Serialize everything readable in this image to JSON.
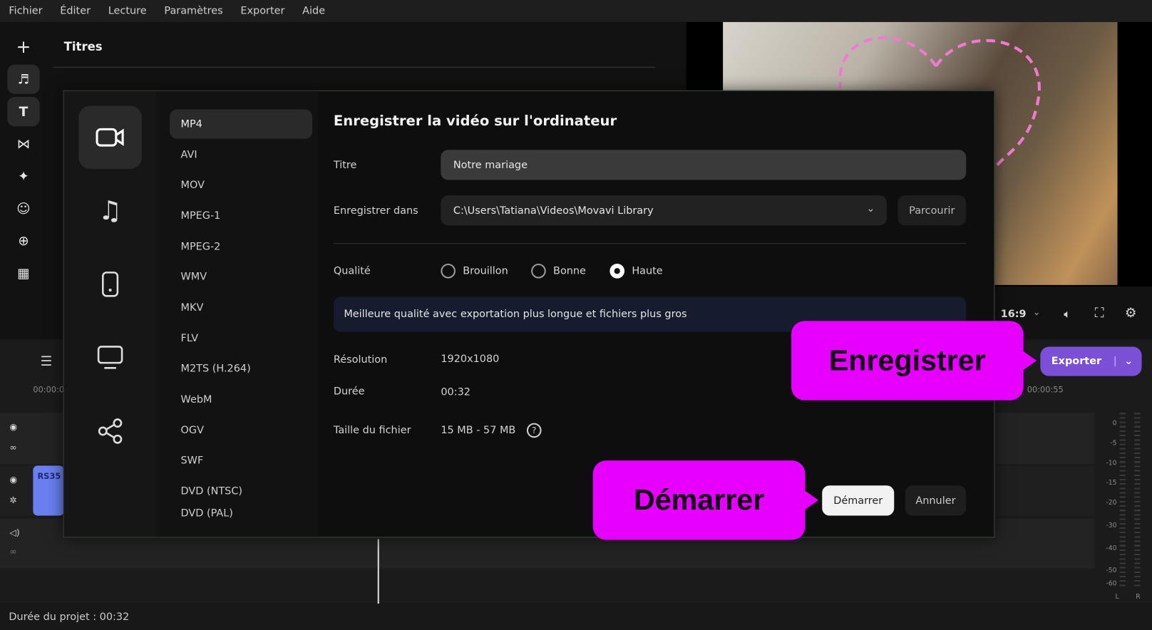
{
  "menu": [
    "Fichier",
    "Éditer",
    "Lecture",
    "Paramètres",
    "Exporter",
    "Aide"
  ],
  "panel": {
    "title": "Titres"
  },
  "player": {
    "aspect": "16:9"
  },
  "timeline": {
    "time_start": "00:00:0",
    "time_end": "00:00:55",
    "clip_label": "RS35"
  },
  "vu_scale": [
    "0",
    "-5",
    "-10",
    "-15",
    "-20",
    "-30",
    "-40",
    "-50",
    "-60"
  ],
  "vu_channels": [
    "L",
    "R"
  ],
  "export_button": "Exporter",
  "footer": {
    "duration": "Durée du projet : 00:32"
  },
  "dialog": {
    "heading": "Enregistrer la vidéo sur l'ordinateur",
    "formats": [
      "MP4",
      "AVI",
      "MOV",
      "MPEG-1",
      "MPEG-2",
      "WMV",
      "MKV",
      "FLV",
      "M2TS (H.264)",
      "WebM",
      "OGV",
      "SWF",
      "DVD (NTSC)",
      "DVD (PAL)"
    ],
    "title_label": "Titre",
    "title_value": "Notre mariage",
    "save_label": "Enregistrer dans",
    "save_path": "C:\\Users\\Tatiana\\Videos\\Movavi Library",
    "browse": "Parcourir",
    "quality_label": "Qualité",
    "quality_options": [
      "Brouillon",
      "Bonne",
      "Haute"
    ],
    "quality_selected": "Haute",
    "quality_hint": "Meilleure qualité avec exportation plus longue et fichiers plus gros",
    "resolution_label": "Résolution",
    "resolution": "1920x1080",
    "duration_label": "Durée",
    "duration": "00:32",
    "size_label": "Taille du fichier",
    "size": "15 MB - 57 MB",
    "start": "Démarrer",
    "cancel": "Annuler"
  },
  "callouts": {
    "save": "Enregistrer",
    "start": "Démarrer"
  },
  "colors": {
    "accent": "#7b4fd6",
    "callout": "#e600ff"
  }
}
